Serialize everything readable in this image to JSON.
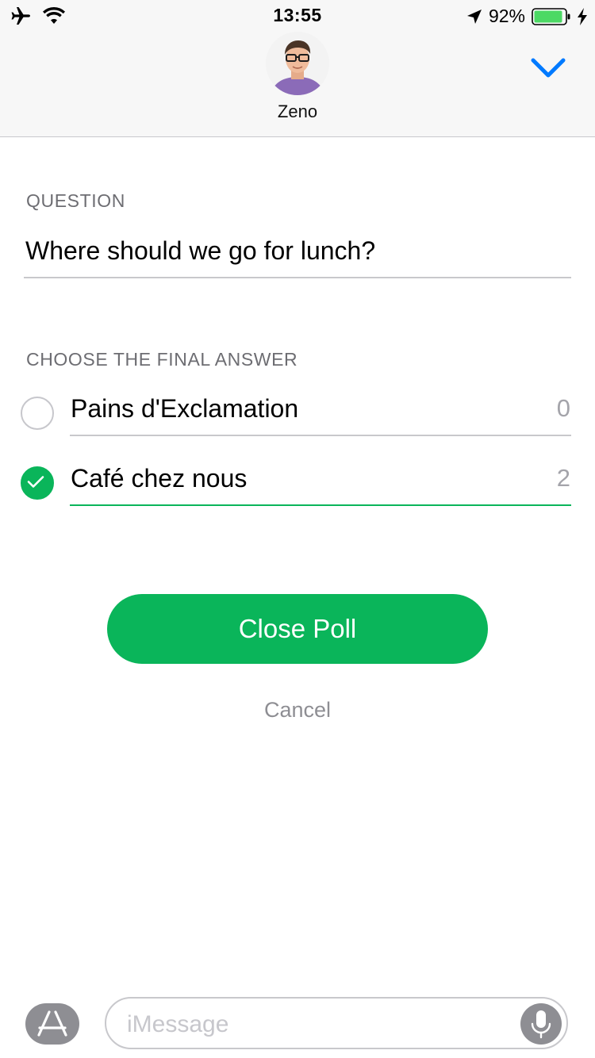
{
  "status_bar": {
    "time": "13:55",
    "battery_percent": "92%",
    "battery_level": 0.92,
    "icons": [
      "airplane-mode-icon",
      "wifi-icon",
      "location-arrow-icon",
      "battery-icon",
      "charging-bolt-icon"
    ]
  },
  "header": {
    "contact_name": "Zeno",
    "collapse_icon": "chevron-down-icon",
    "accent_color": "#007aff"
  },
  "poll": {
    "question_label": "QUESTION",
    "question": "Where should we go for lunch?",
    "answer_label": "CHOOSE THE FINAL ANSWER",
    "options": [
      {
        "label": "Pains d'Exclamation",
        "votes": "0",
        "selected": false
      },
      {
        "label": "Café chez nous",
        "votes": "2",
        "selected": true
      }
    ],
    "close_button": "Close Poll",
    "cancel_label": "Cancel",
    "accent_color": "#0ab55a"
  },
  "input_bar": {
    "placeholder": "iMessage",
    "app_store_icon": "app-store-icon",
    "mic_icon": "microphone-icon"
  }
}
